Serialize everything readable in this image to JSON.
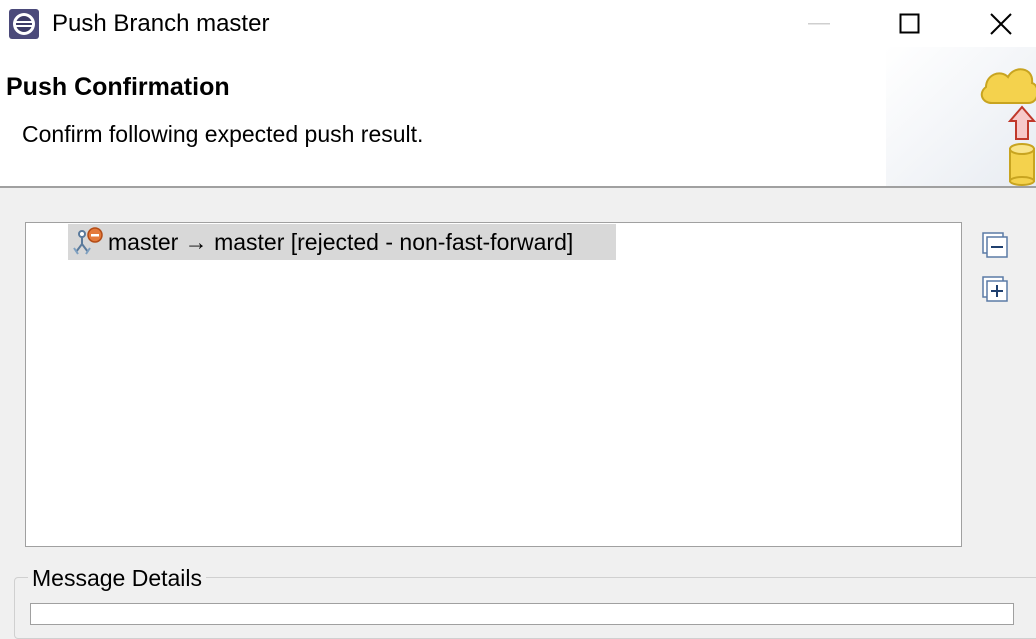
{
  "window": {
    "title": "Push Branch master",
    "controls": [
      "minimize",
      "maximize",
      "close"
    ]
  },
  "header": {
    "title": "Push Confirmation",
    "description": "Confirm following expected push result.",
    "banner_icon": "cloud-push-icon"
  },
  "results": {
    "rows": [
      {
        "icon": "branch-rejected-icon",
        "label": "master → master [rejected - non-fast-forward]"
      }
    ]
  },
  "toolbar": {
    "collapse_icon": "collapse-all-icon",
    "expand_icon": "expand-all-icon"
  },
  "details": {
    "legend": "Message Details"
  }
}
